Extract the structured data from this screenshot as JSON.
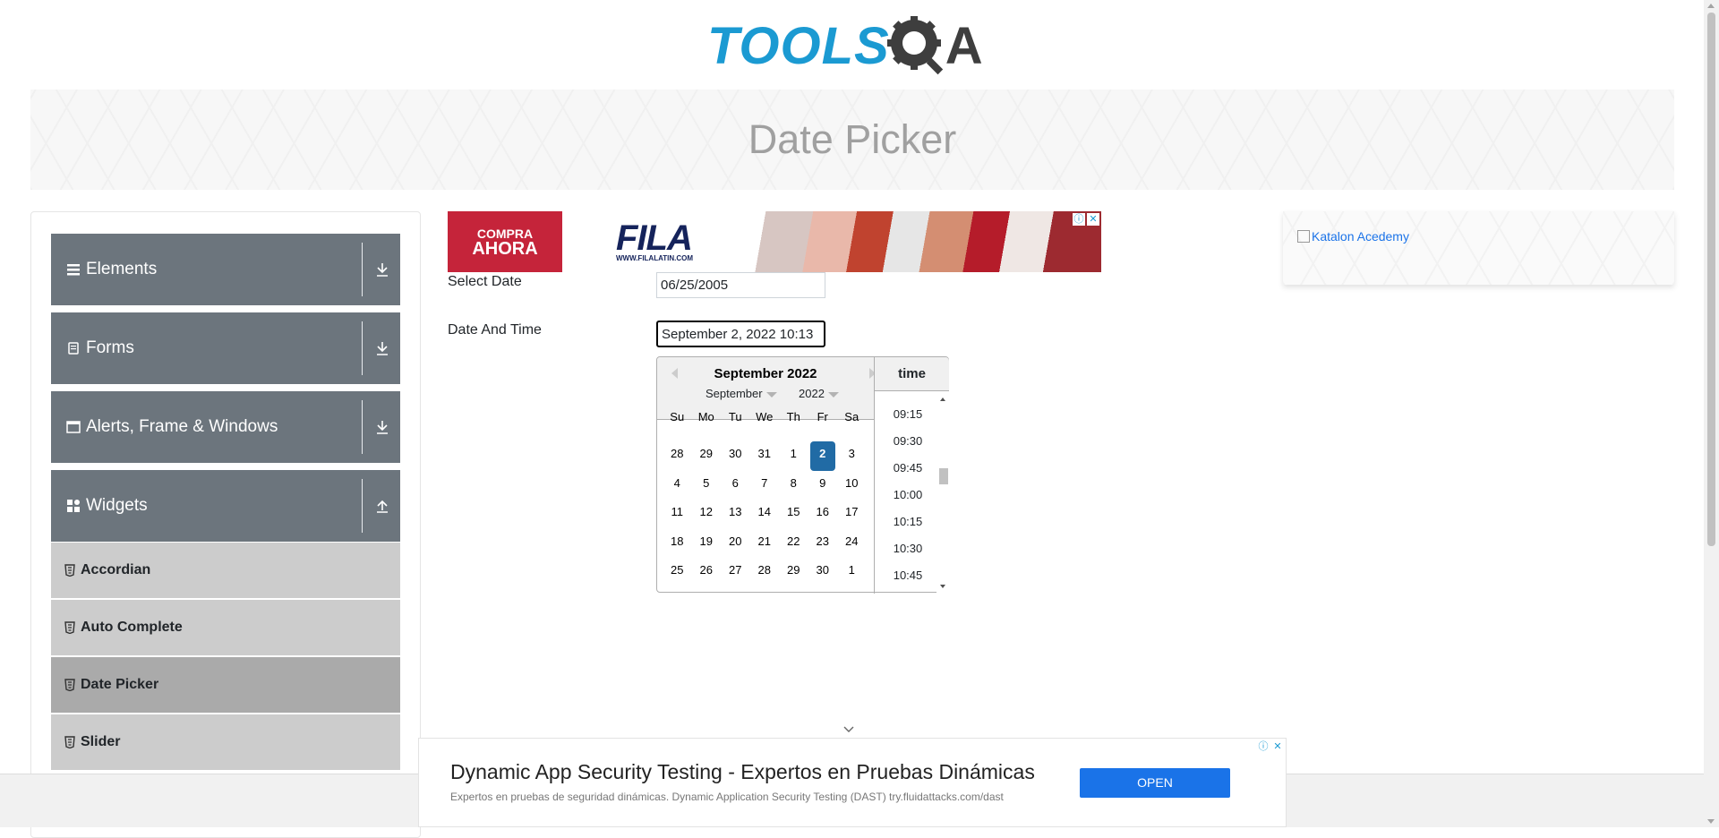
{
  "header": {
    "logo_text": "TOOLS",
    "logo_q": "Q",
    "logo_a": "A"
  },
  "banner": {
    "title": "Date Picker"
  },
  "sidebar": {
    "groups": [
      {
        "label": "Elements"
      },
      {
        "label": "Forms"
      },
      {
        "label": "Alerts, Frame & Windows"
      },
      {
        "label": "Widgets"
      }
    ],
    "items": [
      {
        "label": "Accordian"
      },
      {
        "label": "Auto Complete"
      },
      {
        "label": "Date Picker",
        "active": true
      },
      {
        "label": "Slider"
      }
    ]
  },
  "top_ad": {
    "compra_line1": "COMPRA",
    "compra_line2": "AHORA",
    "brand": "FILA",
    "url": "WWW.FILALATIN.COM",
    "info_icon": "ⓘ",
    "close_icon": "✕"
  },
  "form": {
    "select_date_label": "Select Date",
    "select_date_value": "06/25/2005",
    "date_time_label": "Date And Time",
    "date_time_value": "September 2, 2022 10:13"
  },
  "datepicker": {
    "title": "September 2022",
    "month_select": "September",
    "year_select": "2022",
    "weekdays": [
      "Su",
      "Mo",
      "Tu",
      "We",
      "Th",
      "Fr",
      "Sa"
    ],
    "weeks": [
      [
        "28",
        "29",
        "30",
        "31",
        "1",
        "2",
        "3"
      ],
      [
        "4",
        "5",
        "6",
        "7",
        "8",
        "9",
        "10"
      ],
      [
        "11",
        "12",
        "13",
        "14",
        "15",
        "16",
        "17"
      ],
      [
        "18",
        "19",
        "20",
        "21",
        "22",
        "23",
        "24"
      ],
      [
        "25",
        "26",
        "27",
        "28",
        "29",
        "30",
        "1"
      ]
    ],
    "selected_day": "2",
    "time_header": "time",
    "times": [
      "09:15",
      "09:30",
      "09:45",
      "10:00",
      "10:15",
      "10:30",
      "10:45"
    ]
  },
  "right_ad": {
    "alt_text": "Katalon Acedemy"
  },
  "bottom_ad": {
    "title": "Dynamic App Security Testing - Expertos en Pruebas Dinámicas",
    "subtitle": "Expertos en pruebas de seguridad dinámicas. Dynamic Application Security Testing (DAST) try.fluidattacks.com/dast",
    "button": "OPEN",
    "info_icon": "ⓘ",
    "close_icon": "✕"
  },
  "colors": {
    "brand_blue": "#1b9ad2",
    "sidebar_header": "#6c757d",
    "sidebar_item": "#cccccc",
    "sidebar_item_active": "#aaaaaa",
    "selected_day": "#216ba5",
    "open_button": "#1a73e8"
  }
}
